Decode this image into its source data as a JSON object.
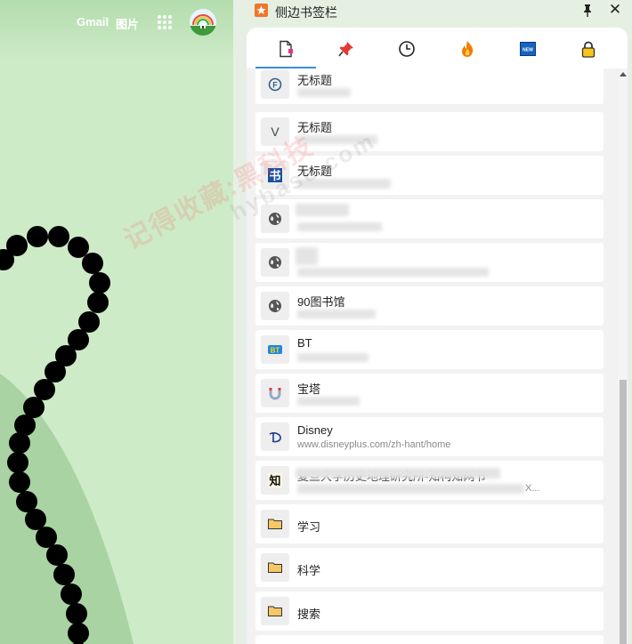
{
  "google_bar": {
    "gmail_label": "Gmail",
    "images_label": "图片",
    "apps_icon": "apps-grid-icon",
    "avatar_icon": "rainbow-avatar-icon"
  },
  "splitter_glyph": "‖",
  "panel": {
    "title": "侧边书签栏",
    "logo_icon": "star-bookmark-icon",
    "pin_icon": "pin-icon",
    "close_glyph": "✕",
    "accent_color": "#3a8be0",
    "tabs": [
      {
        "icon": "bookmark-doc-icon",
        "active": true
      },
      {
        "icon": "push-pin-icon",
        "active": false
      },
      {
        "icon": "clock-history-icon",
        "active": false
      },
      {
        "icon": "flame-icon",
        "active": false
      },
      {
        "icon": "new-badge-icon",
        "active": false
      },
      {
        "icon": "lock-icon",
        "active": false
      }
    ]
  },
  "bookmarks": [
    {
      "title": "无标题",
      "subtitle": "",
      "icon": "circle-f-icon"
    },
    {
      "title": "无标题",
      "subtitle": "",
      "icon": "v-letter-icon"
    },
    {
      "title": "无标题",
      "subtitle": "",
      "icon": "book-shu-icon"
    },
    {
      "title": "",
      "subtitle": "",
      "icon": "globe-icon"
    },
    {
      "title": "",
      "subtitle": "",
      "icon": "globe-icon"
    },
    {
      "title": "90图书馆",
      "subtitle": "",
      "icon": "globe-icon"
    },
    {
      "title": "BT",
      "subtitle": "",
      "icon": "bt-logo-icon"
    },
    {
      "title": "宝塔",
      "subtitle": "",
      "icon": "baota-magnet-icon"
    },
    {
      "title": "Disney",
      "subtitle": "www.disneyplus.com/zh-hant/home",
      "icon": "disney-d-icon"
    },
    {
      "title": "复旦大学历史地理研究所-知构知网节",
      "subtitle": "X...",
      "icon": "zhi-logo-icon"
    },
    {
      "title": "学习",
      "subtitle": "",
      "icon": "folder-icon"
    },
    {
      "title": "科学",
      "subtitle": "",
      "icon": "folder-icon"
    },
    {
      "title": "搜索",
      "subtitle": "",
      "icon": "folder-icon"
    }
  ],
  "watermark": {
    "line1": "记得收藏:黑科技",
    "line2": "hybase.com"
  }
}
